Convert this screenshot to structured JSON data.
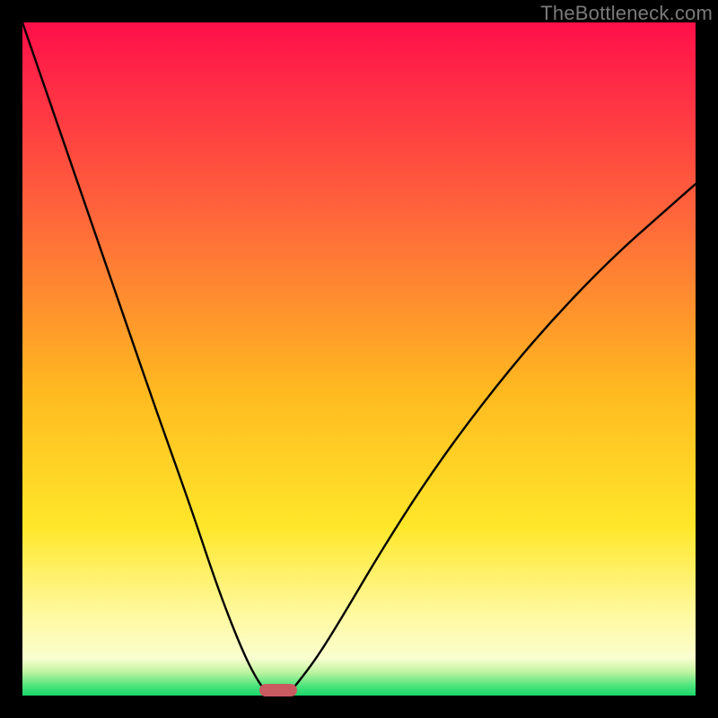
{
  "watermark": {
    "text": "TheBottleneck.com"
  },
  "layout": {
    "outer_size_px": 800,
    "inner_size_px": 750,
    "border_px": 25
  },
  "gradient": {
    "stops": [
      {
        "offset": 0.0,
        "color": "#ff0f4a"
      },
      {
        "offset": 0.3,
        "color": "#ff6a3a"
      },
      {
        "offset": 0.55,
        "color": "#ffba20"
      },
      {
        "offset": 0.75,
        "color": "#ffe72a"
      },
      {
        "offset": 0.88,
        "color": "#fff9a0"
      },
      {
        "offset": 0.945,
        "color": "#fafecf"
      },
      {
        "offset": 0.965,
        "color": "#bff4a0"
      },
      {
        "offset": 0.985,
        "color": "#4ee57c"
      },
      {
        "offset": 1.0,
        "color": "#19d66a"
      }
    ]
  },
  "chart_data": {
    "type": "line",
    "title": "",
    "xlabel": "",
    "ylabel": "",
    "xlim": [
      0,
      1
    ],
    "ylim": [
      0,
      1
    ],
    "note": "Bottleneck-style V-curve. x is a normalized balance axis; y is normalized bottleneck magnitude (0 = no bottleneck at the valley, 1 = max at the upper edges). Values estimated from pixel positions.",
    "series": [
      {
        "name": "left-branch",
        "x": [
          0.0,
          0.05,
          0.1,
          0.15,
          0.2,
          0.25,
          0.285,
          0.31,
          0.33,
          0.345,
          0.358,
          0.367
        ],
        "y": [
          1.0,
          0.855,
          0.71,
          0.565,
          0.42,
          0.28,
          0.175,
          0.108,
          0.06,
          0.03,
          0.01,
          0.0
        ]
      },
      {
        "name": "right-branch",
        "x": [
          0.393,
          0.41,
          0.44,
          0.48,
          0.53,
          0.6,
          0.68,
          0.77,
          0.87,
          0.96,
          1.0
        ],
        "y": [
          0.0,
          0.02,
          0.06,
          0.125,
          0.21,
          0.32,
          0.43,
          0.54,
          0.645,
          0.725,
          0.76
        ]
      }
    ],
    "valley_marker": {
      "x_center": 0.38,
      "y": 0.0,
      "width_frac": 0.056
    }
  }
}
